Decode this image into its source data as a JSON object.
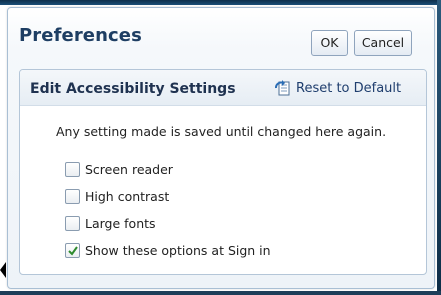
{
  "dialog": {
    "title": "Preferences",
    "ok_label": "OK",
    "cancel_label": "Cancel"
  },
  "panel": {
    "title": "Edit Accessibility Settings",
    "reset_label": "Reset to Default",
    "reset_icon": "reset-document-icon",
    "info_text": "Any setting made is saved until changed here again.",
    "options": [
      {
        "label": "Screen reader",
        "checked": false
      },
      {
        "label": "High contrast",
        "checked": false
      },
      {
        "label": "Large fonts",
        "checked": false
      },
      {
        "label": "Show these options at Sign in",
        "checked": true
      }
    ]
  },
  "colors": {
    "title": "#1e3e63",
    "link": "#1f3e6e",
    "check": "#2e8b2e"
  }
}
